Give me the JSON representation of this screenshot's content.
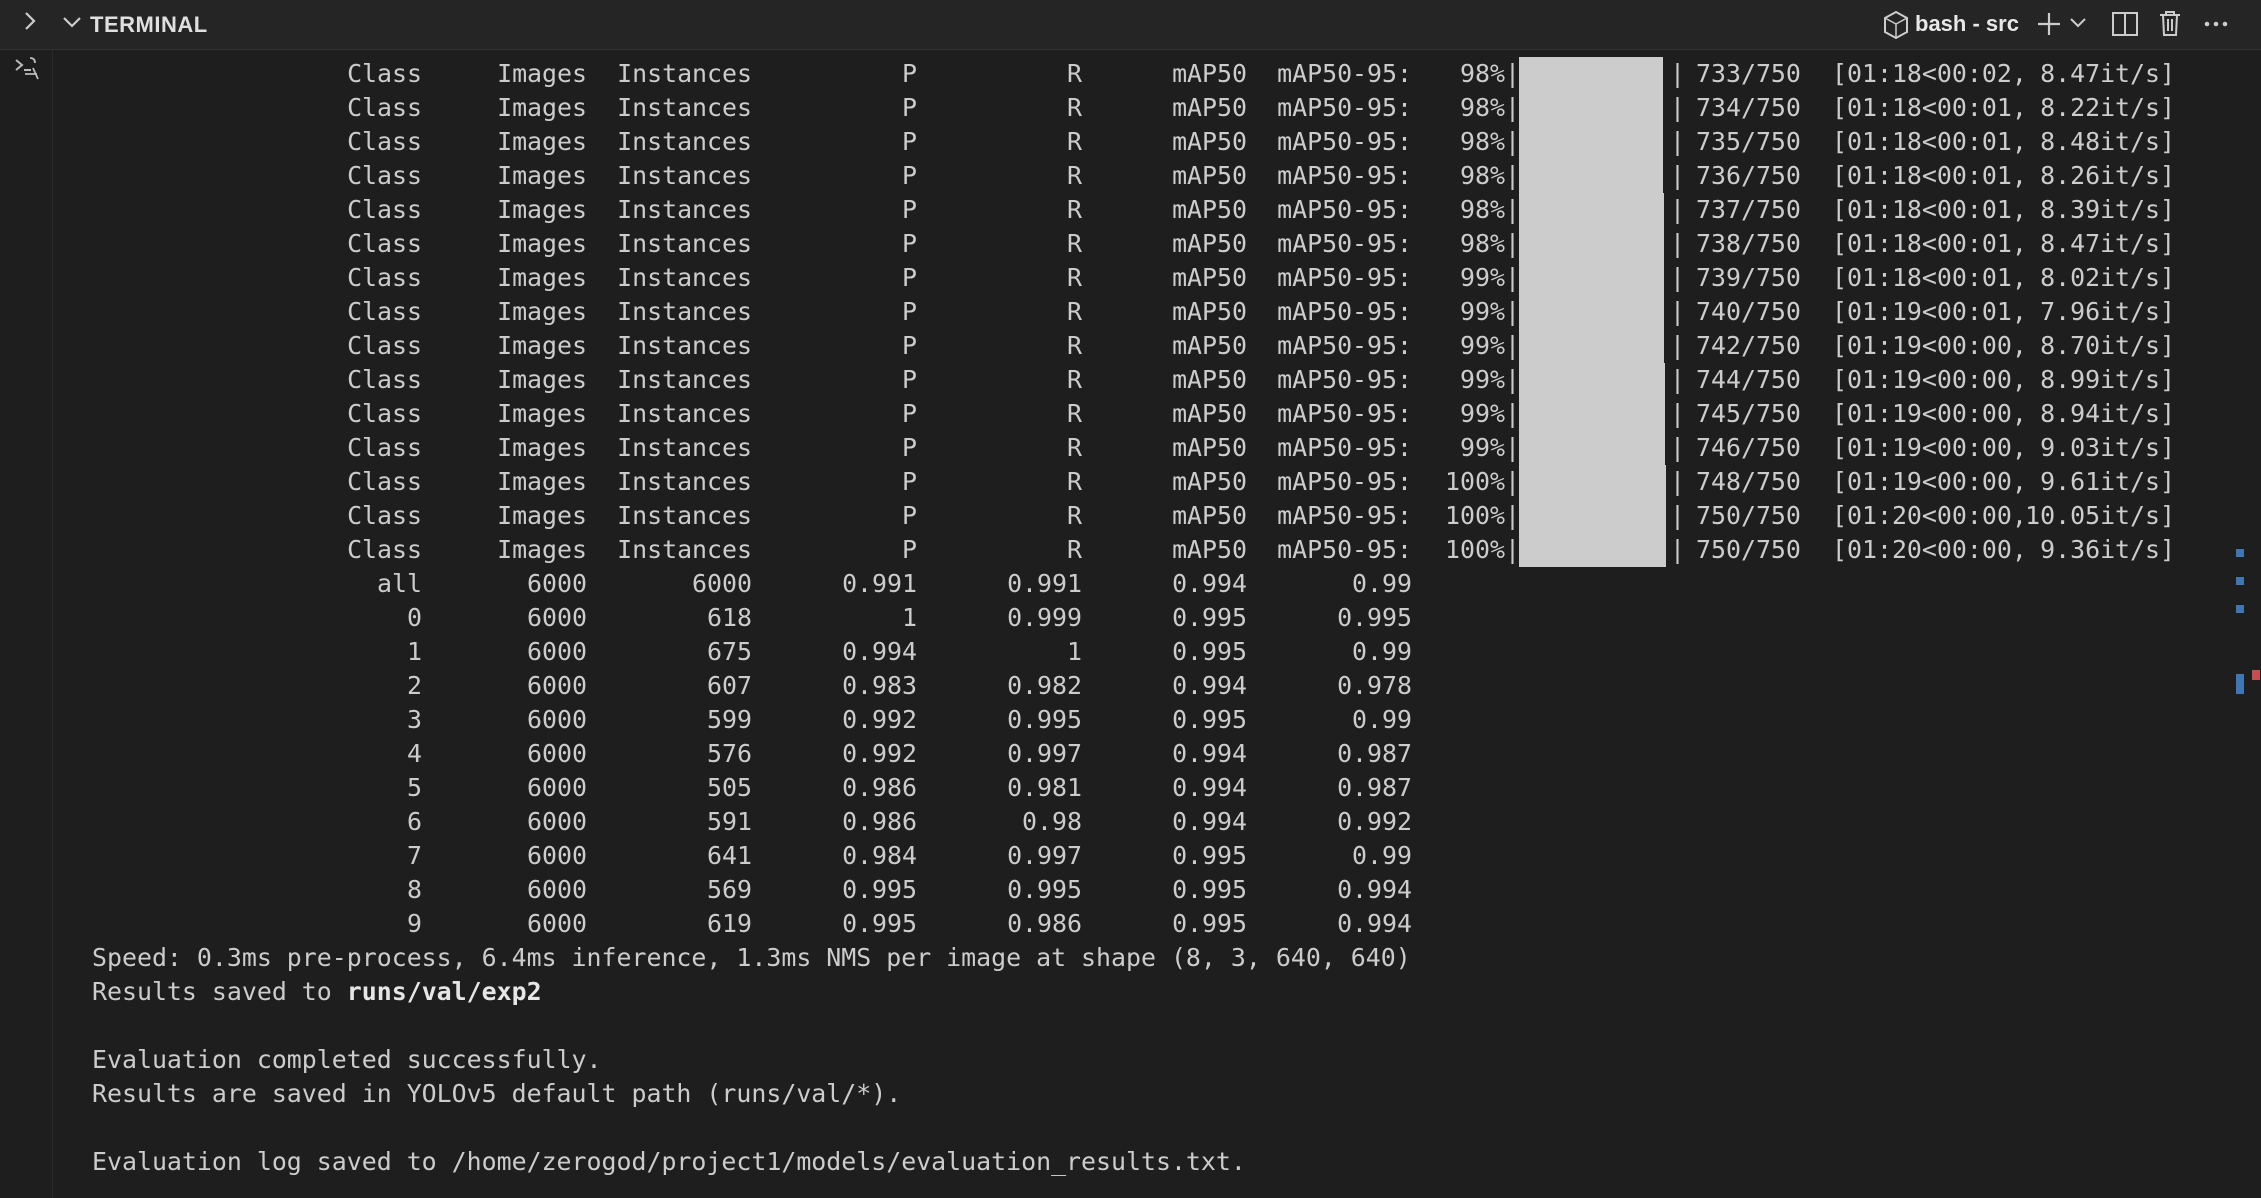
{
  "header": {
    "panel_title": "TERMINAL",
    "terminal_name": "bash - src",
    "icons": [
      "chevron-right-icon",
      "chevron-down-icon",
      "terminal-shell-icon",
      "add-icon",
      "dropdown-chevron-icon",
      "split-icon",
      "trash-icon",
      "more-icon"
    ]
  },
  "progress_rows": [
    {
      "pct": "98%",
      "fill": 0.977,
      "count": "733/750",
      "time": "[01:18<00:02,",
      "rate": "8.47it/s]"
    },
    {
      "pct": "98%",
      "fill": 0.979,
      "count": "734/750",
      "time": "[01:18<00:01,",
      "rate": "8.22it/s]"
    },
    {
      "pct": "98%",
      "fill": 0.98,
      "count": "735/750",
      "time": "[01:18<00:01,",
      "rate": "8.48it/s]"
    },
    {
      "pct": "98%",
      "fill": 0.981,
      "count": "736/750",
      "time": "[01:18<00:01,",
      "rate": "8.26it/s]"
    },
    {
      "pct": "98%",
      "fill": 0.983,
      "count": "737/750",
      "time": "[01:18<00:01,",
      "rate": "8.39it/s]"
    },
    {
      "pct": "98%",
      "fill": 0.984,
      "count": "738/750",
      "time": "[01:18<00:01,",
      "rate": "8.47it/s]"
    },
    {
      "pct": "99%",
      "fill": 0.985,
      "count": "739/750",
      "time": "[01:18<00:01,",
      "rate": "8.02it/s]"
    },
    {
      "pct": "99%",
      "fill": 0.987,
      "count": "740/750",
      "time": "[01:19<00:01,",
      "rate": "7.96it/s]"
    },
    {
      "pct": "99%",
      "fill": 0.989,
      "count": "742/750",
      "time": "[01:19<00:00,",
      "rate": "8.70it/s]"
    },
    {
      "pct": "99%",
      "fill": 0.992,
      "count": "744/750",
      "time": "[01:19<00:00,",
      "rate": "8.99it/s]"
    },
    {
      "pct": "99%",
      "fill": 0.993,
      "count": "745/750",
      "time": "[01:19<00:00,",
      "rate": "8.94it/s]"
    },
    {
      "pct": "99%",
      "fill": 0.995,
      "count": "746/750",
      "time": "[01:19<00:00,",
      "rate": "9.03it/s]"
    },
    {
      "pct": "100%",
      "fill": 0.997,
      "count": "748/750",
      "time": "[01:19<00:00,",
      "rate": "9.61it/s]"
    },
    {
      "pct": "100%",
      "fill": 1.0,
      "count": "750/750",
      "time": "[01:20<00:00,",
      "rate": "10.05it/s]"
    },
    {
      "pct": "100%",
      "fill": 1.0,
      "count": "750/750",
      "time": "[01:20<00:00,",
      "rate": "9.36it/s]"
    }
  ],
  "header_cols": [
    "Class",
    "Images",
    "Instances",
    "P",
    "R",
    "mAP50",
    "mAP50-95:"
  ],
  "results": [
    [
      "all",
      "6000",
      "6000",
      "0.991",
      "0.991",
      "0.994",
      "0.99"
    ],
    [
      "0",
      "6000",
      "618",
      "1",
      "0.999",
      "0.995",
      "0.995"
    ],
    [
      "1",
      "6000",
      "675",
      "0.994",
      "1",
      "0.995",
      "0.99"
    ],
    [
      "2",
      "6000",
      "607",
      "0.983",
      "0.982",
      "0.994",
      "0.978"
    ],
    [
      "3",
      "6000",
      "599",
      "0.992",
      "0.995",
      "0.995",
      "0.99"
    ],
    [
      "4",
      "6000",
      "576",
      "0.992",
      "0.997",
      "0.994",
      "0.987"
    ],
    [
      "5",
      "6000",
      "505",
      "0.986",
      "0.981",
      "0.994",
      "0.987"
    ],
    [
      "6",
      "6000",
      "591",
      "0.986",
      "0.98",
      "0.994",
      "0.992"
    ],
    [
      "7",
      "6000",
      "641",
      "0.984",
      "0.997",
      "0.995",
      "0.99"
    ],
    [
      "8",
      "6000",
      "569",
      "0.995",
      "0.995",
      "0.995",
      "0.994"
    ],
    [
      "9",
      "6000",
      "619",
      "0.995",
      "0.986",
      "0.995",
      "0.994"
    ]
  ],
  "speed_line": "Speed: 0.3ms pre-process, 6.4ms inference, 1.3ms NMS per image at shape (8, 3, 640, 640)",
  "saved_prefix": "Results saved to ",
  "saved_path": "runs/val/exp2",
  "eval_complete": "Evaluation completed successfully.",
  "results_default": "Results are saved in YOLOv5 default path (runs/val/*).",
  "eval_log": "Evaluation log saved to /home/zerogod/project1/models/evaluation_results.txt."
}
